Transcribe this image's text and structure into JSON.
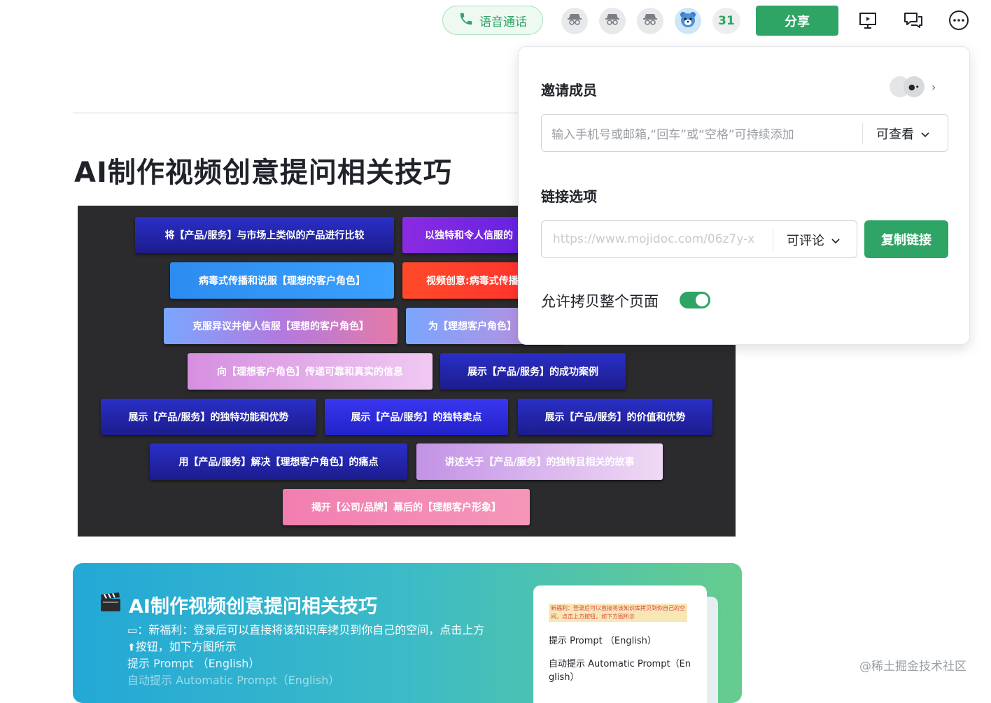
{
  "topbar": {
    "voice_call_label": "语音通话",
    "member_count": "31",
    "share_label": "分享"
  },
  "document": {
    "title": "AI制作视频创意提问相关技巧",
    "mindmap_nodes": [
      "将【产品/服务】与市场上类似的产品进行比较",
      "以独特和令人信服的",
      "病毒式传播和说服【理想的客户角色】",
      "视频创意:病毒式传播",
      "克服异议并使人信服【理想的客户角色】",
      "为【理想客户角色】",
      "向【理想客户角色】传递可靠和真实的信息",
      "展示【产品/服务】的成功案例",
      "展示【产品/服务】的独特功能和优势",
      "展示【产品/服务】的独特卖点",
      "展示【产品/服务】的价值和优势",
      "用【产品/服务】解决【理想客户角色】的痛点",
      "讲述关于【产品/服务】的独特且相关的故事",
      "揭开【公司/品牌】幕后的【理想客户形象】"
    ]
  },
  "banner": {
    "icon": "clapperboard-icon",
    "title": "AI制作视频创意提问相关技巧",
    "line1": "：新福利：登录后可以直接将该知识库拷贝到你自己的空间，点击上方",
    "line2": "按钮，如下方图所示",
    "line3": "提示 Prompt （English）",
    "line4": "自动提示 Automatic Prompt（English）",
    "preview": {
      "highlight": "新福利：登录后可以直接将该知识库拷贝到你自己的空间，点击上方按钮，如下方图所示",
      "item1": "提示 Prompt （English）",
      "item2a": "自动提示 Automatic Prompt（En",
      "item2b": "glish）"
    }
  },
  "share_panel": {
    "invite_heading": "邀请成员",
    "invite_placeholder": "输入手机号或邮箱,“回车”或“空格”可持续添加",
    "invite_permission": "可查看",
    "link_heading": "链接选项",
    "link_url": "https://www.mojidoc.com/06z7y-x",
    "link_permission": "可评论",
    "copy_link_label": "复制链接",
    "allow_copy_label": "允许拷贝整个页面",
    "allow_copy_enabled": true
  },
  "watermark": "@稀土掘金技术社区",
  "colors": {
    "brand_green": "#2ea465",
    "mindmap_bg": "#2b2b2d"
  }
}
